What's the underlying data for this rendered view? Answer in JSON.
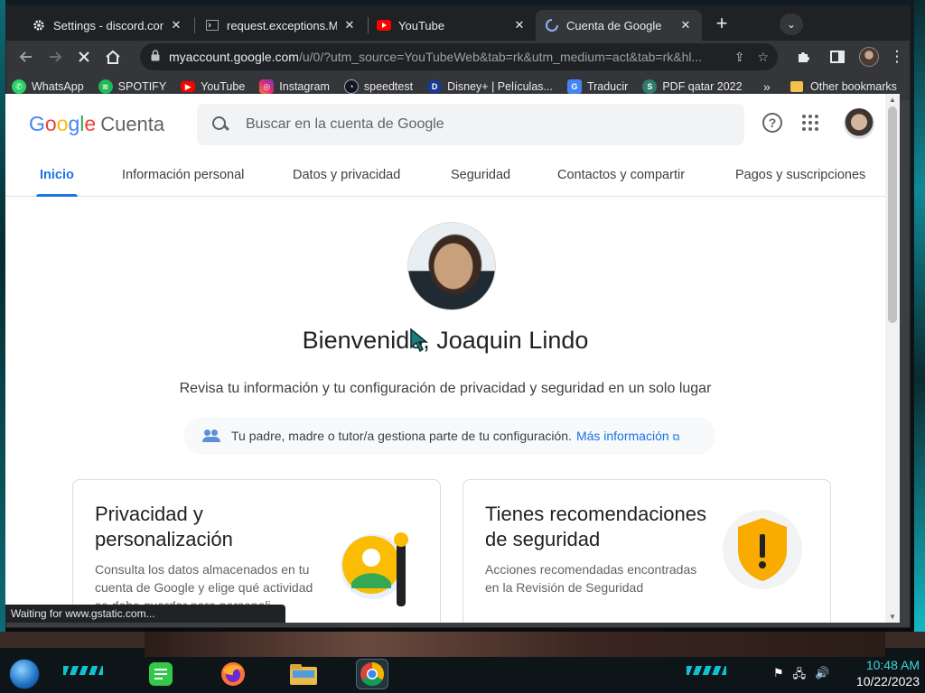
{
  "browser": {
    "tabs": [
      {
        "title": "Settings - discord.com",
        "favicon": "gear-icon"
      },
      {
        "title": "request.exceptions.Missi",
        "favicon": "terminal-icon"
      },
      {
        "title": "YouTube",
        "favicon": "youtube-icon"
      },
      {
        "title": "Cuenta de Google",
        "favicon": "loading-icon"
      }
    ],
    "close_glyph": "✕",
    "new_tab_glyph": "+",
    "url_host": "myaccount.google.com",
    "url_rest": "/u/0/?utm_source=YouTubeWeb&tab=rk&utm_medium=act&tab=rk&hl...",
    "bookmarks": [
      {
        "label": "WhatsApp",
        "icon": "whatsapp-icon",
        "color": "#25d366"
      },
      {
        "label": "SPOTIFY",
        "icon": "spotify-icon",
        "color": "#1db954"
      },
      {
        "label": "YouTube",
        "icon": "youtube-icon",
        "color": "#ff0000"
      },
      {
        "label": "Instagram",
        "icon": "instagram-icon",
        "color": "#d6249f"
      },
      {
        "label": "speedtest",
        "icon": "speedtest-icon",
        "color": "#141526"
      },
      {
        "label": "Disney+ | Películas...",
        "icon": "disney-icon",
        "color": "#1a3a8f"
      },
      {
        "label": "Traducir",
        "icon": "translate-icon",
        "color": "#4285f4"
      },
      {
        "label": "PDF qatar 2022",
        "icon": "pdf-s-icon",
        "color": "#2e7d6b"
      }
    ],
    "bookmarks_more": "»",
    "other_bookmarks": "Other bookmarks",
    "status_text": "Waiting for www.gstatic.com..."
  },
  "google": {
    "logo_letters": [
      {
        "ch": "G",
        "color": "#4285f4"
      },
      {
        "ch": "o",
        "color": "#ea4335"
      },
      {
        "ch": "o",
        "color": "#fbbc05"
      },
      {
        "ch": "g",
        "color": "#4285f4"
      },
      {
        "ch": "l",
        "color": "#34a853"
      },
      {
        "ch": "e",
        "color": "#ea4335"
      }
    ],
    "product": "Cuenta",
    "search_placeholder": "Buscar en la cuenta de Google",
    "help_glyph": "?",
    "nav": [
      "Inicio",
      "Información personal",
      "Datos y privacidad",
      "Seguridad",
      "Contactos y compartir",
      "Pagos y suscripciones"
    ],
    "active_nav": "Inicio",
    "welcome": "Bienvenido, Joaquin Lindo",
    "subtitle": "Revisa tu información y tu configuración de privacidad y seguridad en un solo lugar",
    "notice_text": "Tu padre, madre o tutor/a gestiona parte de tu configuración.",
    "notice_link": "Más información",
    "cards": [
      {
        "title": "Privacidad y personalización",
        "body": "Consulta los datos almacenados en tu cuenta de Google y elige qué actividad se debe guardar para personali-"
      },
      {
        "title": "Tienes recomendaciones de seguridad",
        "body": "Acciones recomendadas encontradas en la Revisión de Seguridad"
      }
    ],
    "accent": "#1a73e8"
  },
  "taskbar": {
    "time": "10:48 AM",
    "date": "10/22/2023",
    "apps": [
      "notes-icon",
      "firefox-icon",
      "file-explorer-icon",
      "chrome-icon"
    ]
  }
}
